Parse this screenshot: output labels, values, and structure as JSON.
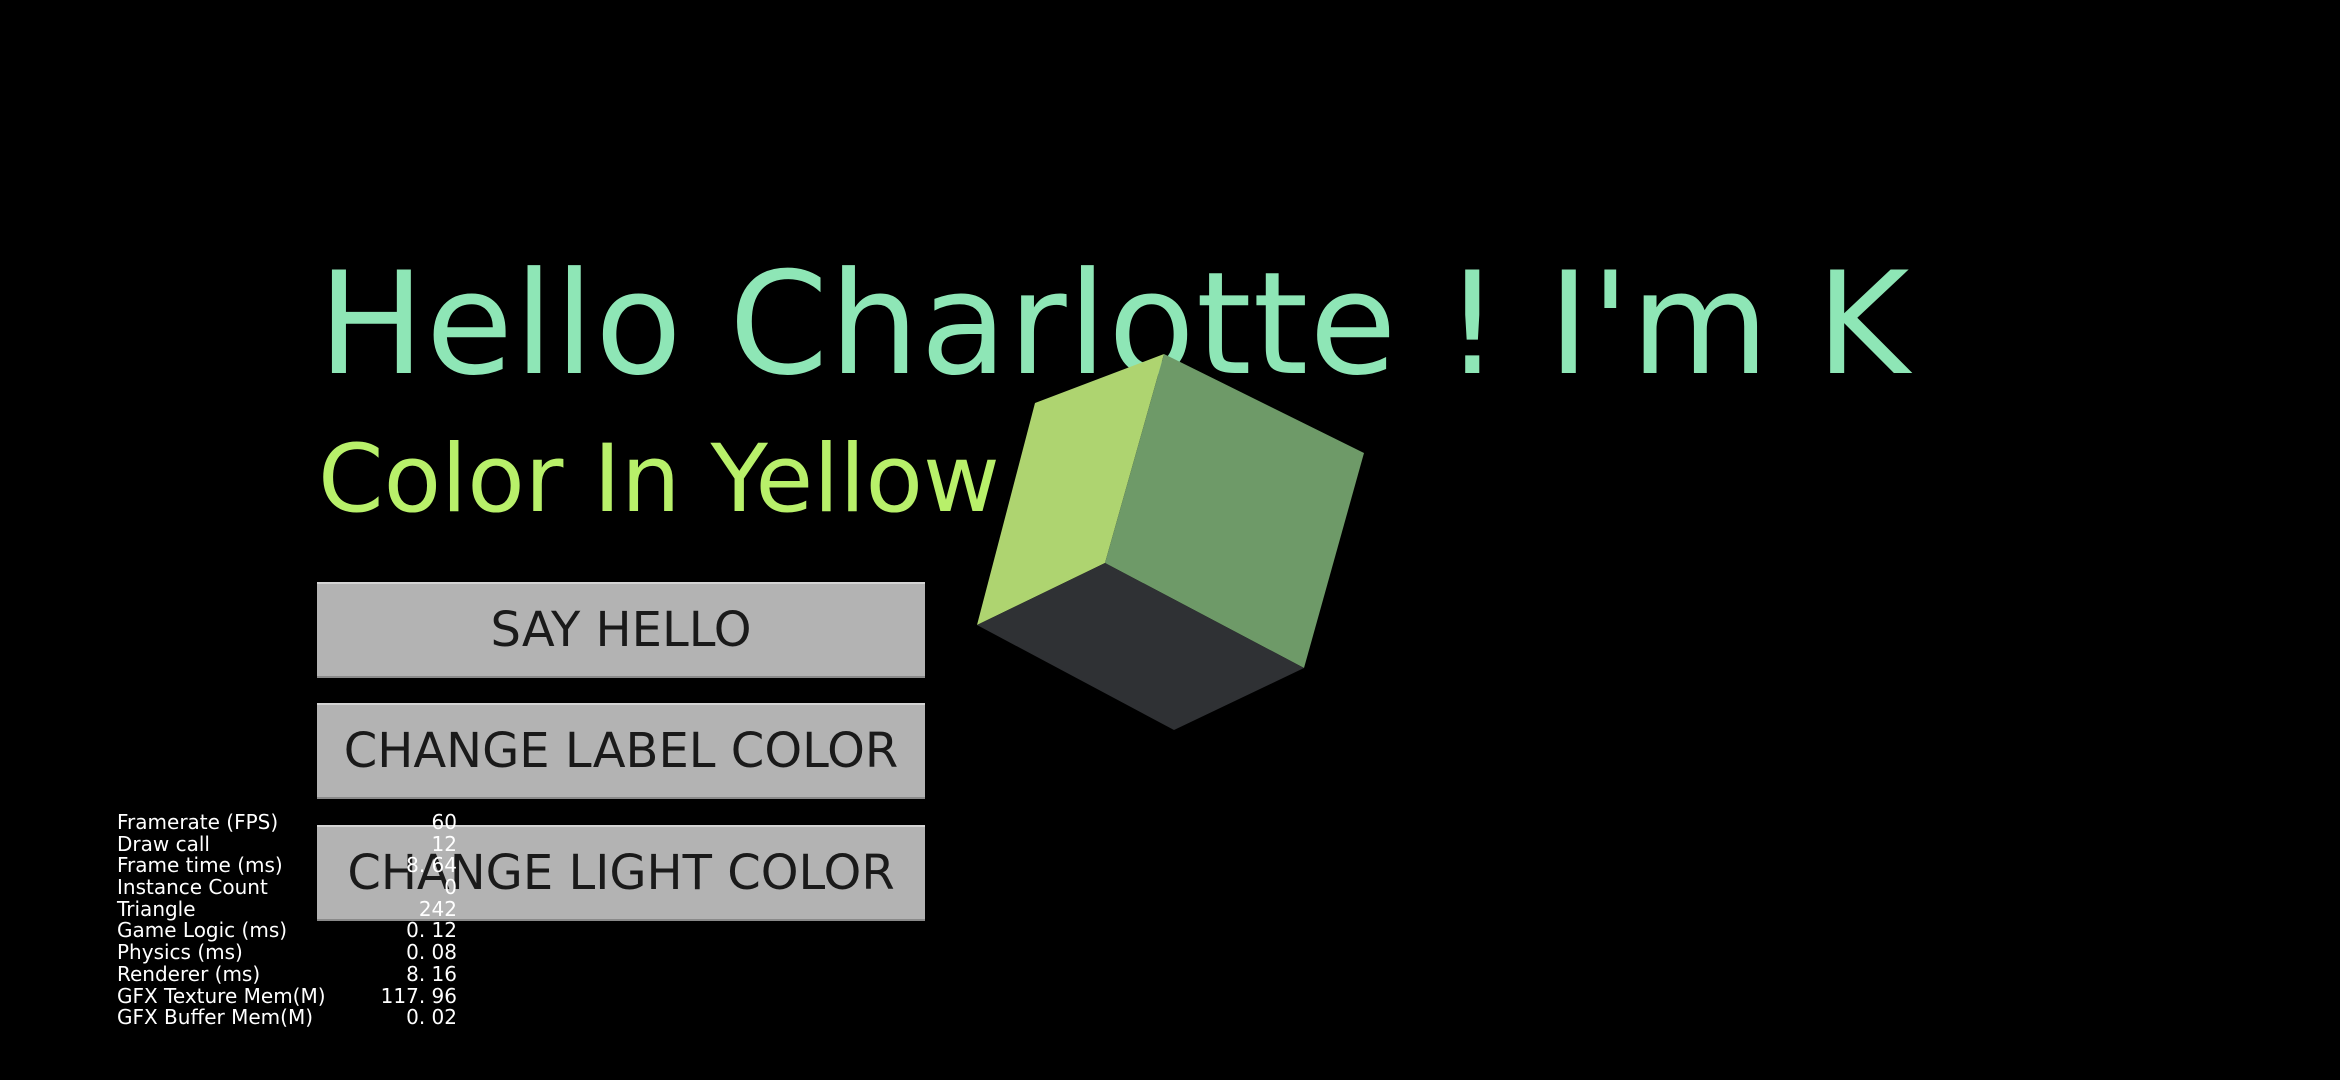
{
  "scene": {
    "hello_text": "Hello Charlotte ! I'm K",
    "color_text": "Color In Yellow ~",
    "colors": {
      "hello_text": "#8ee6b6",
      "color_text": "#b8f06a",
      "cube_left_face": "#aed470",
      "cube_right_face": "#6e9a68",
      "cube_bottom_face": "#2f3134",
      "background": "#000000"
    }
  },
  "buttons": {
    "say_hello": "SAY HELLO",
    "change_label_color": "CHANGE LABEL COLOR",
    "change_light_color": "CHANGE LIGHT COLOR"
  },
  "stats": [
    {
      "name": "Framerate (FPS)",
      "value": "60"
    },
    {
      "name": "Draw call",
      "value": "12"
    },
    {
      "name": "Frame time (ms)",
      "value": "8. 64"
    },
    {
      "name": "Instance Count",
      "value": "0"
    },
    {
      "name": "Triangle",
      "value": "242"
    },
    {
      "name": "Game Logic (ms)",
      "value": "0. 12"
    },
    {
      "name": "Physics (ms)",
      "value": "0. 08"
    },
    {
      "name": "Renderer (ms)",
      "value": "8. 16"
    },
    {
      "name": "GFX Texture Mem(M)",
      "value": "117. 96"
    },
    {
      "name": "GFX Buffer Mem(M)",
      "value": "0. 02"
    }
  ]
}
